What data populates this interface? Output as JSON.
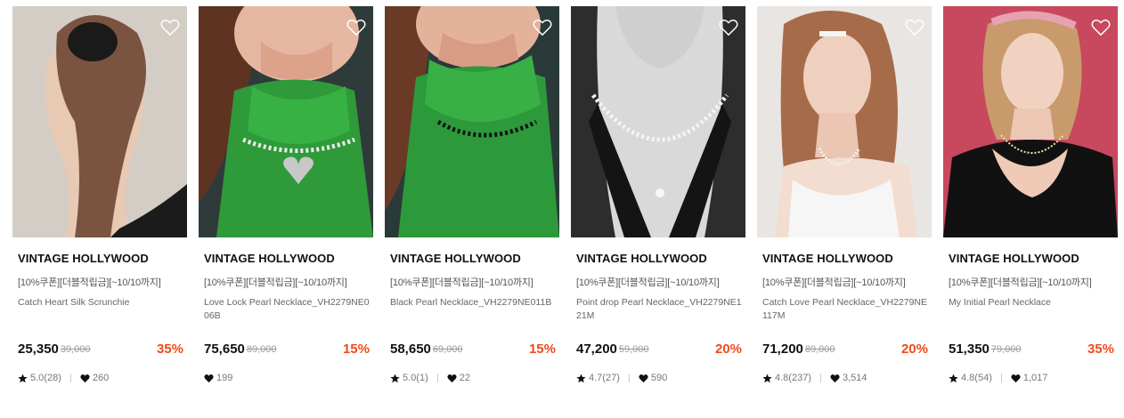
{
  "colors": {
    "discount": "#f04a1a",
    "brand_text": "#111111",
    "muted_text": "#777777"
  },
  "icons": {
    "wishlist": "heart-outline-icon",
    "rating": "star-icon",
    "likes": "heart-filled-icon"
  },
  "products": [
    {
      "brand": "VINTAGE HOLLYWOOD",
      "promo": "[10%쿠폰][더블적립금][~10/10까지]",
      "name": "Catch Heart Silk Scrunchie",
      "price": "25,350",
      "original_price": "39,000",
      "discount": "35%",
      "rating": "5.0(28)",
      "likes": "260"
    },
    {
      "brand": "VINTAGE HOLLYWOOD",
      "promo": "[10%쿠폰][더블적립금][~10/10까지]",
      "name": "Love Lock Pearl Necklace_VH2279NE006B",
      "price": "75,650",
      "original_price": "89,000",
      "discount": "15%",
      "rating": "",
      "likes": "199"
    },
    {
      "brand": "VINTAGE HOLLYWOOD",
      "promo": "[10%쿠폰][더블적립금][~10/10까지]",
      "name": "Black Pearl Necklace_VH2279NE011B",
      "price": "58,650",
      "original_price": "69,000",
      "discount": "15%",
      "rating": "5.0(1)",
      "likes": "22"
    },
    {
      "brand": "VINTAGE HOLLYWOOD",
      "promo": "[10%쿠폰][더블적립금][~10/10까지]",
      "name": "Point drop Pearl Necklace_VH2279NE121M",
      "price": "47,200",
      "original_price": "59,000",
      "discount": "20%",
      "rating": "4.7(27)",
      "likes": "590"
    },
    {
      "brand": "VINTAGE HOLLYWOOD",
      "promo": "[10%쿠폰][더블적립금][~10/10까지]",
      "name": "Catch Love Pearl Necklace_VH2279NE117M",
      "price": "71,200",
      "original_price": "89,000",
      "discount": "20%",
      "rating": "4.8(237)",
      "likes": "3,514"
    },
    {
      "brand": "VINTAGE HOLLYWOOD",
      "promo": "[10%쿠폰][더블적립금][~10/10까지]",
      "name": "My Initial Pearl Necklace",
      "price": "51,350",
      "original_price": "79,000",
      "discount": "35%",
      "rating": "4.8(54)",
      "likes": "1,017"
    }
  ]
}
